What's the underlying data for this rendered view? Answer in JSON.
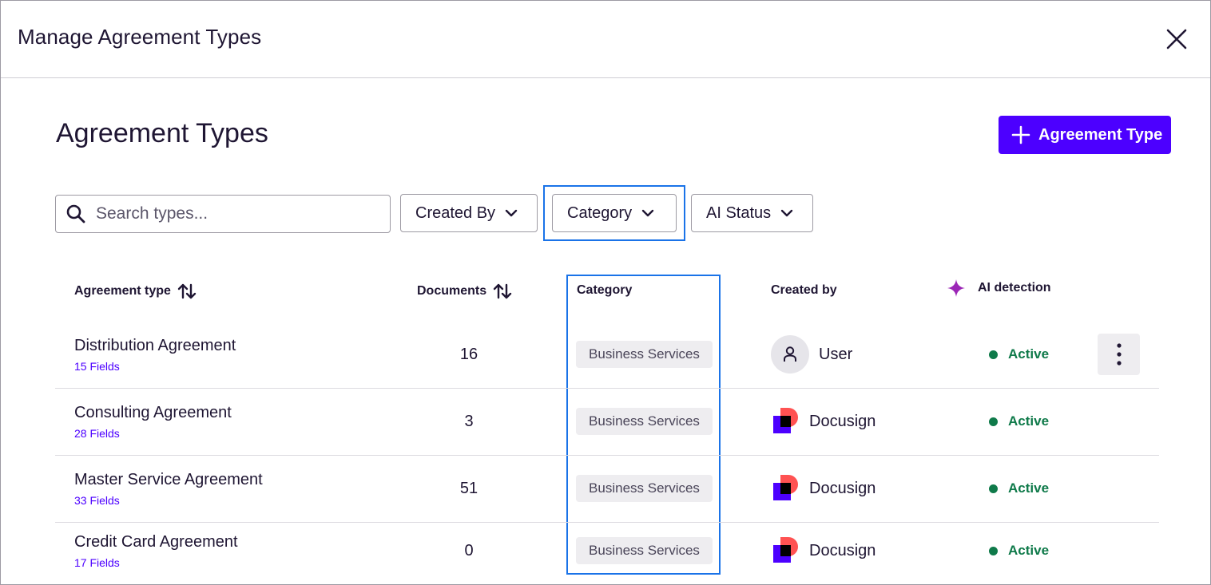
{
  "modal": {
    "title": "Manage Agreement Types"
  },
  "page": {
    "title": "Agreement Types",
    "add_button_label": "Agreement Type"
  },
  "search": {
    "placeholder": "Search types...",
    "value": ""
  },
  "filters": [
    {
      "label": "Created By"
    },
    {
      "label": "Category"
    },
    {
      "label": "AI Status"
    }
  ],
  "table": {
    "headers": {
      "agreement_type": "Agreement type",
      "documents": "Documents",
      "category": "Category",
      "created_by": "Created by",
      "ai_detection": "AI detection"
    },
    "rows": [
      {
        "name": "Distribution Agreement",
        "fields": "15 Fields",
        "documents": "16",
        "category": "Business Services",
        "created_by": "User",
        "creator_kind": "user",
        "status": "Active"
      },
      {
        "name": "Consulting Agreement",
        "fields": "28 Fields",
        "documents": "3",
        "category": "Business Services",
        "created_by": "Docusign",
        "creator_kind": "docusign",
        "status": "Active"
      },
      {
        "name": "Master Service Agreement",
        "fields": "33 Fields",
        "documents": "51",
        "category": "Business Services",
        "created_by": "Docusign",
        "creator_kind": "docusign",
        "status": "Active"
      },
      {
        "name": "Credit Card Agreement",
        "fields": "17 Fields",
        "documents": "0",
        "category": "Business Services",
        "created_by": "Docusign",
        "creator_kind": "docusign",
        "status": "Active"
      }
    ]
  },
  "colors": {
    "accent": "#4c00ff",
    "status_active": "#0f7a4a",
    "highlight": "#1a73e8",
    "ai_sparkle": "#9b26b6"
  }
}
